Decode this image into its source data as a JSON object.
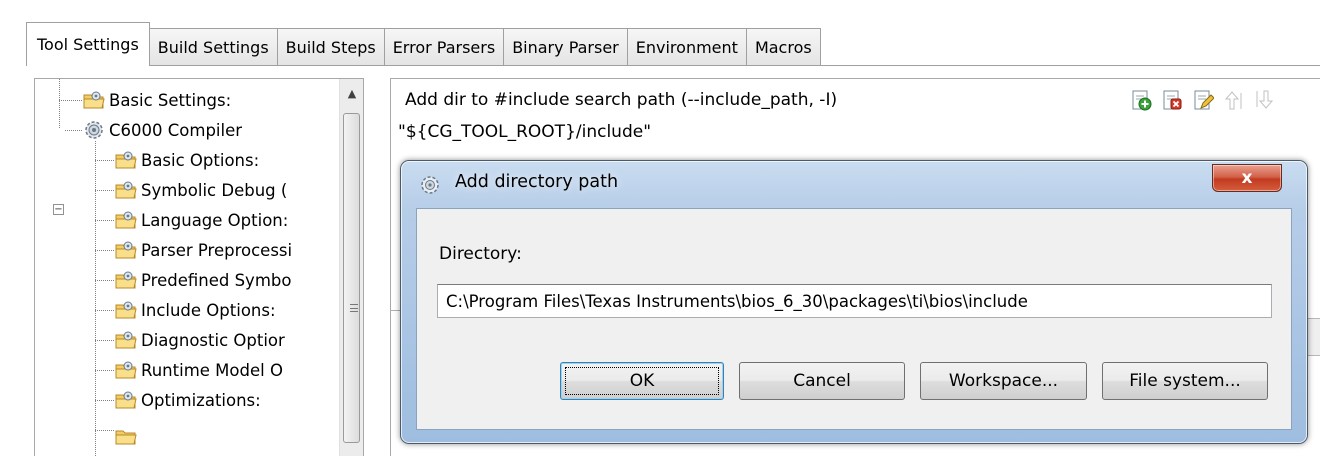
{
  "tabs": [
    {
      "label": "Tool Settings",
      "active": true
    },
    {
      "label": "Build Settings",
      "active": false
    },
    {
      "label": "Build Steps",
      "active": false
    },
    {
      "label": "Error Parsers",
      "active": false
    },
    {
      "label": "Binary Parser",
      "active": false
    },
    {
      "label": "Environment",
      "active": false
    },
    {
      "label": "Macros",
      "active": false
    }
  ],
  "tree": {
    "items": [
      {
        "label": "Basic Settings:",
        "icon": "folder-settings-icon"
      },
      {
        "label": "C6000 Compiler",
        "icon": "gear-icon"
      },
      {
        "label": "Basic Options:",
        "icon": "folder-settings-icon"
      },
      {
        "label": "Symbolic Debug (",
        "icon": "folder-settings-icon"
      },
      {
        "label": "Language Option:",
        "icon": "folder-settings-icon"
      },
      {
        "label": "Parser Preprocessi",
        "icon": "folder-settings-icon"
      },
      {
        "label": "Predefined Symbo",
        "icon": "folder-settings-icon"
      },
      {
        "label": "Include Options:",
        "icon": "folder-settings-icon"
      },
      {
        "label": "Diagnostic Optior",
        "icon": "folder-settings-icon"
      },
      {
        "label": "Runtime Model O",
        "icon": "folder-settings-icon"
      },
      {
        "label": "Optimizations:",
        "icon": "folder-settings-icon"
      }
    ],
    "expander_symbol": "−",
    "scroll_up_symbol": "▲"
  },
  "right_panel": {
    "title": "Add dir to #include search path (--include_path, -I)",
    "path_value": "\"${CG_TOOL_ROOT}/include\"",
    "toolbar_icons": [
      "add-icon",
      "delete-icon",
      "edit-icon",
      "move-up-icon",
      "move-down-icon"
    ]
  },
  "dialog": {
    "title": "Add directory path",
    "close_symbol": "x",
    "directory_label": "Directory:",
    "directory_value": "C:\\Program Files\\Texas Instruments\\bios_6_30\\packages\\ti\\bios\\include",
    "buttons": {
      "ok": "OK",
      "cancel": "Cancel",
      "workspace": "Workspace...",
      "file_system": "File system..."
    }
  },
  "colors": {
    "dialog_frame": "#aac5e4",
    "close_button": "#c23a1f",
    "default_button_border": "#3c7fb1"
  }
}
